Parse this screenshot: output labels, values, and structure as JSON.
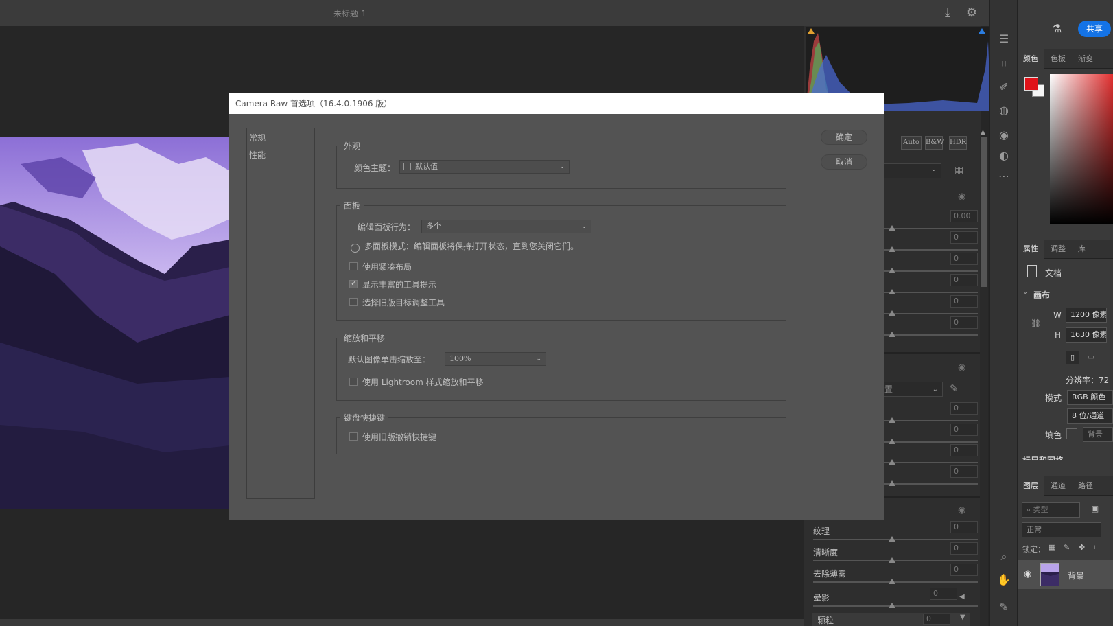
{
  "window": {
    "doc_title": "未标题-1"
  },
  "share_label": "共享",
  "cr_panel": {
    "mode_buttons": [
      "Auto",
      "B&W",
      "HDR"
    ],
    "top_slider_values": [
      "0.00",
      "0",
      "0",
      "0",
      "0",
      "0"
    ],
    "mid_slider_values": [
      "0",
      "0",
      "0",
      "0"
    ],
    "profile_text": "置",
    "effects": [
      {
        "label": "纹理",
        "value": "0"
      },
      {
        "label": "清晰度",
        "value": "0"
      },
      {
        "label": "去除薄雾",
        "value": "0"
      },
      {
        "label": "晕影",
        "value": "0"
      },
      {
        "label": "颗粒",
        "value": "0"
      }
    ]
  },
  "ps_panel": {
    "color_tabs": [
      "颜色",
      "色板",
      "渐变"
    ],
    "prop_tabs": [
      "属性",
      "调整",
      "库"
    ],
    "doc_label": "文档",
    "canvas_label": "画布",
    "w_label": "W",
    "w_value": "1200 像素",
    "h_label": "H",
    "h_value": "1630 像素",
    "resolution": "分辨率：72",
    "mode_label": "模式",
    "mode_value": "RGB 颜色",
    "depth_value": "8 位/通道",
    "fill_label": "填色",
    "fill_value": "背景",
    "cut_section": "标尺和网格",
    "layer_tabs": [
      "图层",
      "通道",
      "路径"
    ],
    "search_placeholder": "类型",
    "blend_mode": "正常",
    "lock_label": "锁定：",
    "layer_name": "背景"
  },
  "dialog": {
    "title": "Camera Raw 首选项（16.4.0.1906 版）",
    "nav": [
      "常规",
      "性能"
    ],
    "ok": "确定",
    "cancel": "取消",
    "appearance": {
      "title": "外观",
      "theme_label": "颜色主题：",
      "theme_value": "默认值"
    },
    "panels": {
      "title": "面板",
      "edit_label": "编辑面板行为：",
      "edit_value": "多个",
      "info": "多面板模式：编辑面板将保持打开状态，直到您关闭它们。",
      "compact": "使用紧凑布局",
      "tooltips": "显示丰富的工具提示",
      "legacy_tat": "选择旧版目标调整工具"
    },
    "zoom": {
      "title": "缩放和平移",
      "default_label": "默认图像单击缩放至：",
      "default_value": "100%",
      "lr_style": "使用 Lightroom 样式缩放和平移"
    },
    "keys": {
      "title": "键盘快捷键",
      "legacy_undo": "使用旧版撤销快捷键"
    }
  }
}
